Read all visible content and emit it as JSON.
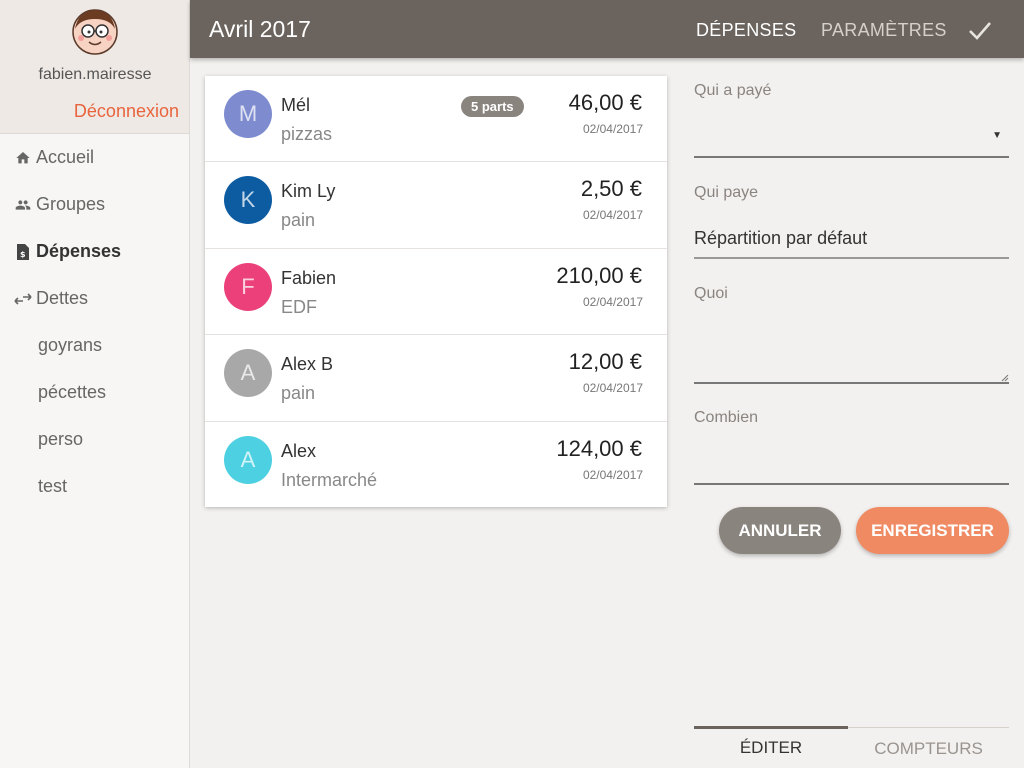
{
  "user": {
    "name": "fabien.mairesse",
    "logout_label": "Déconnexion"
  },
  "sidebar": {
    "items": [
      {
        "label": "Accueil",
        "icon": "home-icon"
      },
      {
        "label": "Groupes",
        "icon": "group-icon"
      },
      {
        "label": "Dépenses",
        "icon": "receipt-icon",
        "active": true
      },
      {
        "label": "Dettes",
        "icon": "swap-arrows-icon"
      }
    ],
    "groups": [
      "goyrans",
      "pécettes",
      "perso",
      "test"
    ]
  },
  "header": {
    "title": "Avril 2017",
    "tabs": [
      "DÉPENSES",
      "PARAMÈTRES"
    ],
    "confirm_icon": "check-icon"
  },
  "expenses": [
    {
      "initial": "M",
      "payer": "Mél",
      "description": "pizzas",
      "badge": "5 parts",
      "amount": "46,00 €",
      "date": "02/04/2017",
      "color": "#7e8ccf"
    },
    {
      "initial": "K",
      "payer": "Kim Ly",
      "description": "pain",
      "badge": "",
      "amount": "2,50 €",
      "date": "02/04/2017",
      "color": "#0d5ca1"
    },
    {
      "initial": "F",
      "payer": "Fabien",
      "description": "EDF",
      "badge": "",
      "amount": "210,00 €",
      "date": "02/04/2017",
      "color": "#ec407a"
    },
    {
      "initial": "A",
      "payer": "Alex B",
      "description": "pain",
      "badge": "",
      "amount": "12,00 €",
      "date": "02/04/2017",
      "color": "#a8a8a8"
    },
    {
      "initial": "A",
      "payer": "Alex",
      "description": "Intermarché",
      "badge": "",
      "amount": "124,00 €",
      "date": "02/04/2017",
      "color": "#4dd0e1"
    }
  ],
  "form": {
    "who_paid_label": "Qui a payé",
    "who_paid_value": "",
    "who_pays_label": "Qui paye",
    "who_pays_value": "Répartition par défaut",
    "what_label": "Quoi",
    "what_value": "",
    "amount_label": "Combien",
    "amount_value": "",
    "cancel_label": "ANNULER",
    "save_label": "ENREGISTRER"
  },
  "bottom_tabs": [
    "ÉDITER",
    "COMPTEURS"
  ],
  "colors": {
    "topbar": "#6b645e",
    "accent": "#ef8a63",
    "logout": "#e8643c"
  }
}
